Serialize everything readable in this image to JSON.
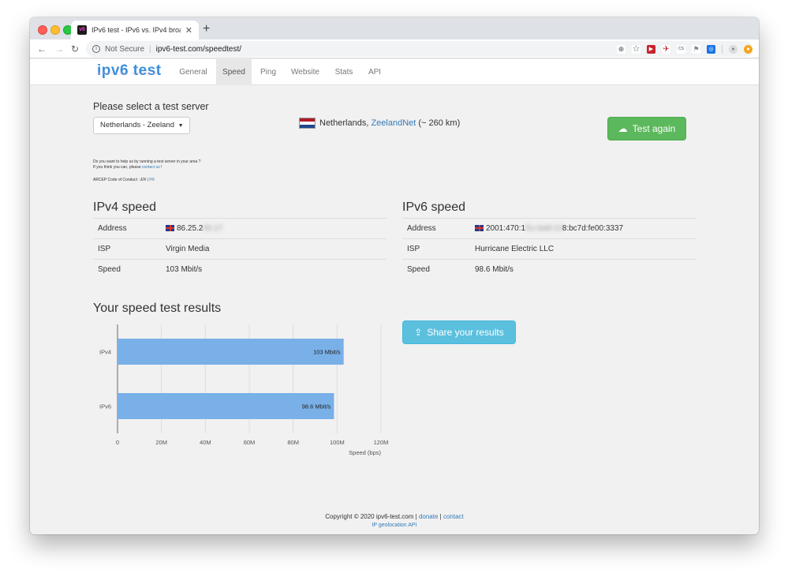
{
  "browser": {
    "tab_title": "IPv6 test - IPv6 vs. IPv4 broad",
    "favicon_text": "v6",
    "security_label": "Not Secure",
    "url": "ipv6-test.com/speedtest/"
  },
  "site": {
    "brand": "ipv6 test",
    "nav": [
      "General",
      "Speed",
      "Ping",
      "Website",
      "Stats",
      "API"
    ],
    "active_nav": "Speed"
  },
  "server": {
    "heading": "Please select a test server",
    "selected": "Netherlands - Zeeland",
    "help_line1": "Do you want to help us by running a test server in your area ?",
    "help_line2_prefix": "If you think you can, please ",
    "help_link": "contact us",
    "help_line2_suffix": " !",
    "coc_prefix": "ARCEP Code of Conduct : ",
    "coc_en": "EN",
    "coc_sep": " | ",
    "coc_fr": "FR",
    "location_country": "Netherlands, ",
    "location_isp": "ZeelandNet",
    "location_distance": " (~ 260 km)",
    "test_again": "Test again"
  },
  "ipv4": {
    "title": "IPv4 speed",
    "labels": [
      "Address",
      "ISP",
      "Speed"
    ],
    "address_visible": "86.25.2",
    "address_blurred": "00.17",
    "isp": "Virgin Media",
    "speed": "103 Mbit/s"
  },
  "ipv6": {
    "title": "IPv6 speed",
    "labels": [
      "Address",
      "ISP",
      "Speed"
    ],
    "address_visible": "2001:470:1",
    "address_blurred": "f1c:ba9:13",
    "address_end": "8:bc7d:fe00:3337",
    "isp": "Hurricane Electric LLC",
    "speed": "98.6 Mbit/s"
  },
  "results": {
    "title": "Your speed test results",
    "share": "Share your results"
  },
  "chart_data": {
    "type": "bar",
    "orientation": "horizontal",
    "categories": [
      "IPv4",
      "IPv6"
    ],
    "values": [
      103,
      98.6
    ],
    "data_labels": [
      "103 Mbit/s",
      "98.6 Mbit/s"
    ],
    "xlabel": "Speed (bps)",
    "x_ticks": [
      0,
      20,
      40,
      60,
      80,
      100,
      120
    ],
    "x_tick_labels": [
      "0",
      "20M",
      "40M",
      "60M",
      "80M",
      "100M",
      "120M"
    ],
    "xlim": [
      0,
      120
    ],
    "bar_color": "#7ab0e8",
    "grid": true
  },
  "footer": {
    "copyright": "Copyright © 2020 ipv6-test.com",
    "sep": " | ",
    "donate": "donate",
    "contact": "contact",
    "geo_api": "IP geolocation API"
  },
  "colors": {
    "accent": "#337ab7",
    "success": "#5cb85c",
    "info": "#5bc0de"
  }
}
